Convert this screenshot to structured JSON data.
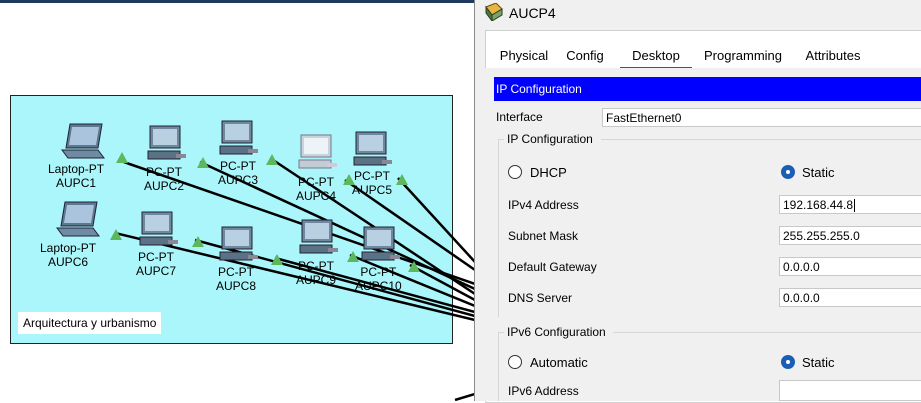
{
  "workspace": {
    "cluster_label": "Arquitectura y urbanismo",
    "devices": [
      {
        "type": "Laptop-PT",
        "name": "AUPC1"
      },
      {
        "type": "PC-PT",
        "name": "AUPC2"
      },
      {
        "type": "PC-PT",
        "name": "AUPC3"
      },
      {
        "type": "PC-PT",
        "name": "AUPC4"
      },
      {
        "type": "PC-PT",
        "name": "AUPC5"
      },
      {
        "type": "Laptop-PT",
        "name": "AUPC6"
      },
      {
        "type": "PC-PT",
        "name": "AUPC7"
      },
      {
        "type": "PC-PT",
        "name": "AUPC8"
      },
      {
        "type": "PC-PT",
        "name": "AUPC9"
      },
      {
        "type": "PC-PT",
        "name": "AUPC10"
      }
    ],
    "colors": {
      "cluster_bg": "#aaf6fa",
      "link": "#000000",
      "link_indicator": "#5cb85c"
    }
  },
  "window": {
    "title": "AUCP4",
    "tabs": [
      "Physical",
      "Config",
      "Desktop",
      "Programming",
      "Attributes"
    ],
    "active_tab": "Desktop"
  },
  "ip_config": {
    "header": "IP Configuration",
    "interface_label": "Interface",
    "interface_value": "FastEthernet0",
    "ipv4_group_label": "IP Configuration",
    "dhcp_label": "DHCP",
    "static_label": "Static",
    "ipv4_mode": "Static",
    "ipv4_address_label": "IPv4 Address",
    "ipv4_address": "192.168.44.8",
    "subnet_mask_label": "Subnet Mask",
    "subnet_mask": "255.255.255.0",
    "gateway_label": "Default Gateway",
    "gateway": "0.0.0.0",
    "dns_label": "DNS Server",
    "dns": "0.0.0.0",
    "ipv6_group_label": "IPv6 Configuration",
    "automatic_label": "Automatic",
    "ipv6_static_label": "Static",
    "ipv6_mode": "Static",
    "ipv6_address_label": "IPv6 Address",
    "ipv6_address": ""
  }
}
